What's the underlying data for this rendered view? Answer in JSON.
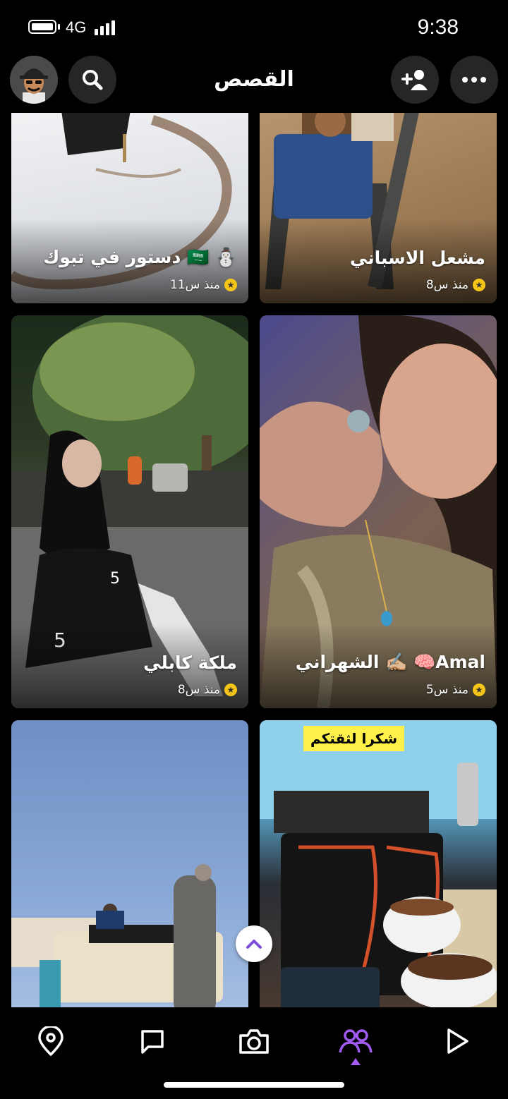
{
  "status_bar": {
    "network": "4G",
    "time": "9:38"
  },
  "header": {
    "title": "القصص"
  },
  "stories": [
    {
      "name": "مشعل الاسباني",
      "time": "منذ س8"
    },
    {
      "name": "دستور في تبوك 🇸🇦 ⛄",
      "time": "منذ س11"
    },
    {
      "name": "الشهراني ✍🏼 🧠Amal",
      "time": "منذ س5"
    },
    {
      "name": "ملكة كابلي",
      "time": "منذ س8"
    },
    {
      "overlay_text": "شكرا لثقتكم"
    },
    {}
  ],
  "colors": {
    "accent": "#a05cf0",
    "background": "#000000",
    "button_bg": "#262626"
  },
  "nav": {
    "items": [
      "map-icon",
      "chat-icon",
      "camera-icon",
      "stories-icon",
      "spotlight-icon"
    ],
    "active": "stories-icon"
  }
}
